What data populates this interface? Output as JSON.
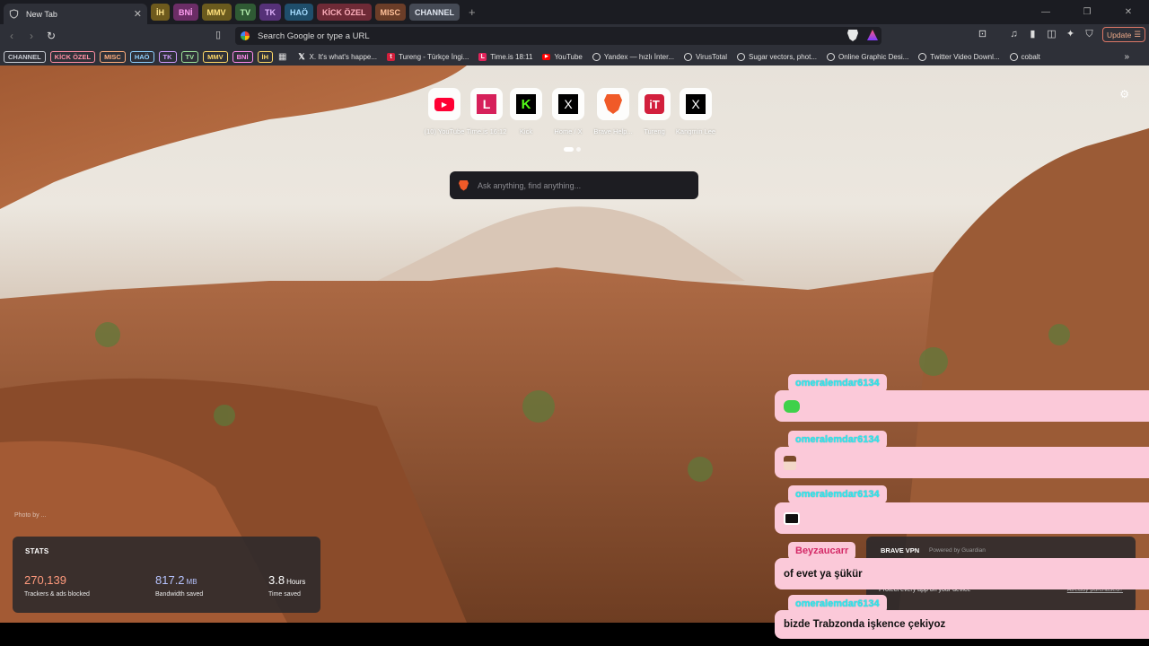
{
  "tabstrip": {
    "active_tab_title": "New Tab",
    "groups": [
      {
        "label": "İH",
        "bg": "#6e5a1d",
        "fg": "#ffe48a"
      },
      {
        "label": "BNİ",
        "bg": "#6b2d66",
        "fg": "#ff9ef2"
      },
      {
        "label": "MMV",
        "bg": "#6a5a1e",
        "fg": "#ffe07a"
      },
      {
        "label": "TV",
        "bg": "#2f5a34",
        "fg": "#b6f0b0"
      },
      {
        "label": "TK",
        "bg": "#553178",
        "fg": "#e2b6ff"
      },
      {
        "label": "HAÖ",
        "bg": "#1f4e6b",
        "fg": "#a6dcff"
      },
      {
        "label": "KİCK ÖZEL",
        "bg": "#6e2a36",
        "fg": "#ffb0bd"
      },
      {
        "label": "MISC",
        "bg": "#6b3d28",
        "fg": "#ffc19b"
      },
      {
        "label": "CHANNEL",
        "bg": "#454a55",
        "fg": "#e0e6f0"
      }
    ]
  },
  "toolbar": {
    "omnibox_placeholder": "Search Google or type a URL",
    "update_label": "Update"
  },
  "bookmarks": {
    "groups": [
      {
        "label": "CHANNEL",
        "color": "#c8ccd4"
      },
      {
        "label": "KİCK ÖZEL",
        "color": "#ff8fa3"
      },
      {
        "label": "MISC",
        "color": "#ffae7d"
      },
      {
        "label": "HAÖ",
        "color": "#8fd0ff"
      },
      {
        "label": "TK",
        "color": "#d09cff"
      },
      {
        "label": "TV",
        "color": "#9ee39a"
      },
      {
        "label": "MMV",
        "color": "#ffd866"
      },
      {
        "label": "BNİ",
        "color": "#ff8ced"
      },
      {
        "label": "İH",
        "color": "#ffd866"
      }
    ],
    "items": [
      {
        "label": "X. It's what's happe...",
        "icon": "x-icon"
      },
      {
        "label": "Tureng - Türkçe İngi...",
        "icon": "tureng-icon"
      },
      {
        "label": "Time.is 18:11",
        "icon": "timeis-icon"
      },
      {
        "label": "YouTube",
        "icon": "youtube-icon"
      },
      {
        "label": "Yandex — hızlı İnter...",
        "icon": "globe-icon"
      },
      {
        "label": "VirusTotal",
        "icon": "globe-icon"
      },
      {
        "label": "Sugar vectors, phot...",
        "icon": "globe-icon"
      },
      {
        "label": "Online Graphic Desi...",
        "icon": "globe-icon"
      },
      {
        "label": "Twitter Video Downl...",
        "icon": "globe-icon"
      },
      {
        "label": "cobalt",
        "icon": "globe-icon"
      }
    ]
  },
  "topsites": [
    {
      "label": "(10) YouTube",
      "icon": "youtube-icon"
    },
    {
      "label": "Time.is 16:12",
      "icon": "timeis-icon"
    },
    {
      "label": "Kick",
      "icon": "kick-icon"
    },
    {
      "label": "Home / X",
      "icon": "x-icon"
    },
    {
      "label": "Brave Help...",
      "icon": "brave-icon"
    },
    {
      "label": "Tureng",
      "icon": "tureng-icon"
    },
    {
      "label": "Kangmin Lee",
      "icon": "x-icon"
    }
  ],
  "search": {
    "placeholder": "Ask anything, find anything..."
  },
  "photo_credit": "Photo by ...",
  "stats": {
    "title": "STATS",
    "trackers_value": "270,139",
    "trackers_label": "Trackers & ads blocked",
    "bandwidth_value": "817.2",
    "bandwidth_unit": "MB",
    "bandwidth_label": "Bandwidth saved",
    "time_value": "3.8",
    "time_unit": "Hours",
    "time_label": "Time saved"
  },
  "vpn": {
    "title": "BRAVE VPN",
    "powered": "Powered by Guardian",
    "desc": "Protect every app on your device",
    "link": "Already purchased?"
  },
  "chat": [
    {
      "user": "omeralemdar6134",
      "text": "",
      "emote": "green-emote"
    },
    {
      "user": "omeralemdar6134",
      "text": "",
      "emote": "anime-emote"
    },
    {
      "user": "omeralemdar6134",
      "text": "",
      "emote": "dark-emote"
    },
    {
      "user": "Beyzaucarr",
      "text": "of evet ya şükür",
      "emote": ""
    },
    {
      "user": "omeralemdar6134",
      "text": "bizde Trabzonda işkence çekiyoz",
      "emote": ""
    }
  ]
}
